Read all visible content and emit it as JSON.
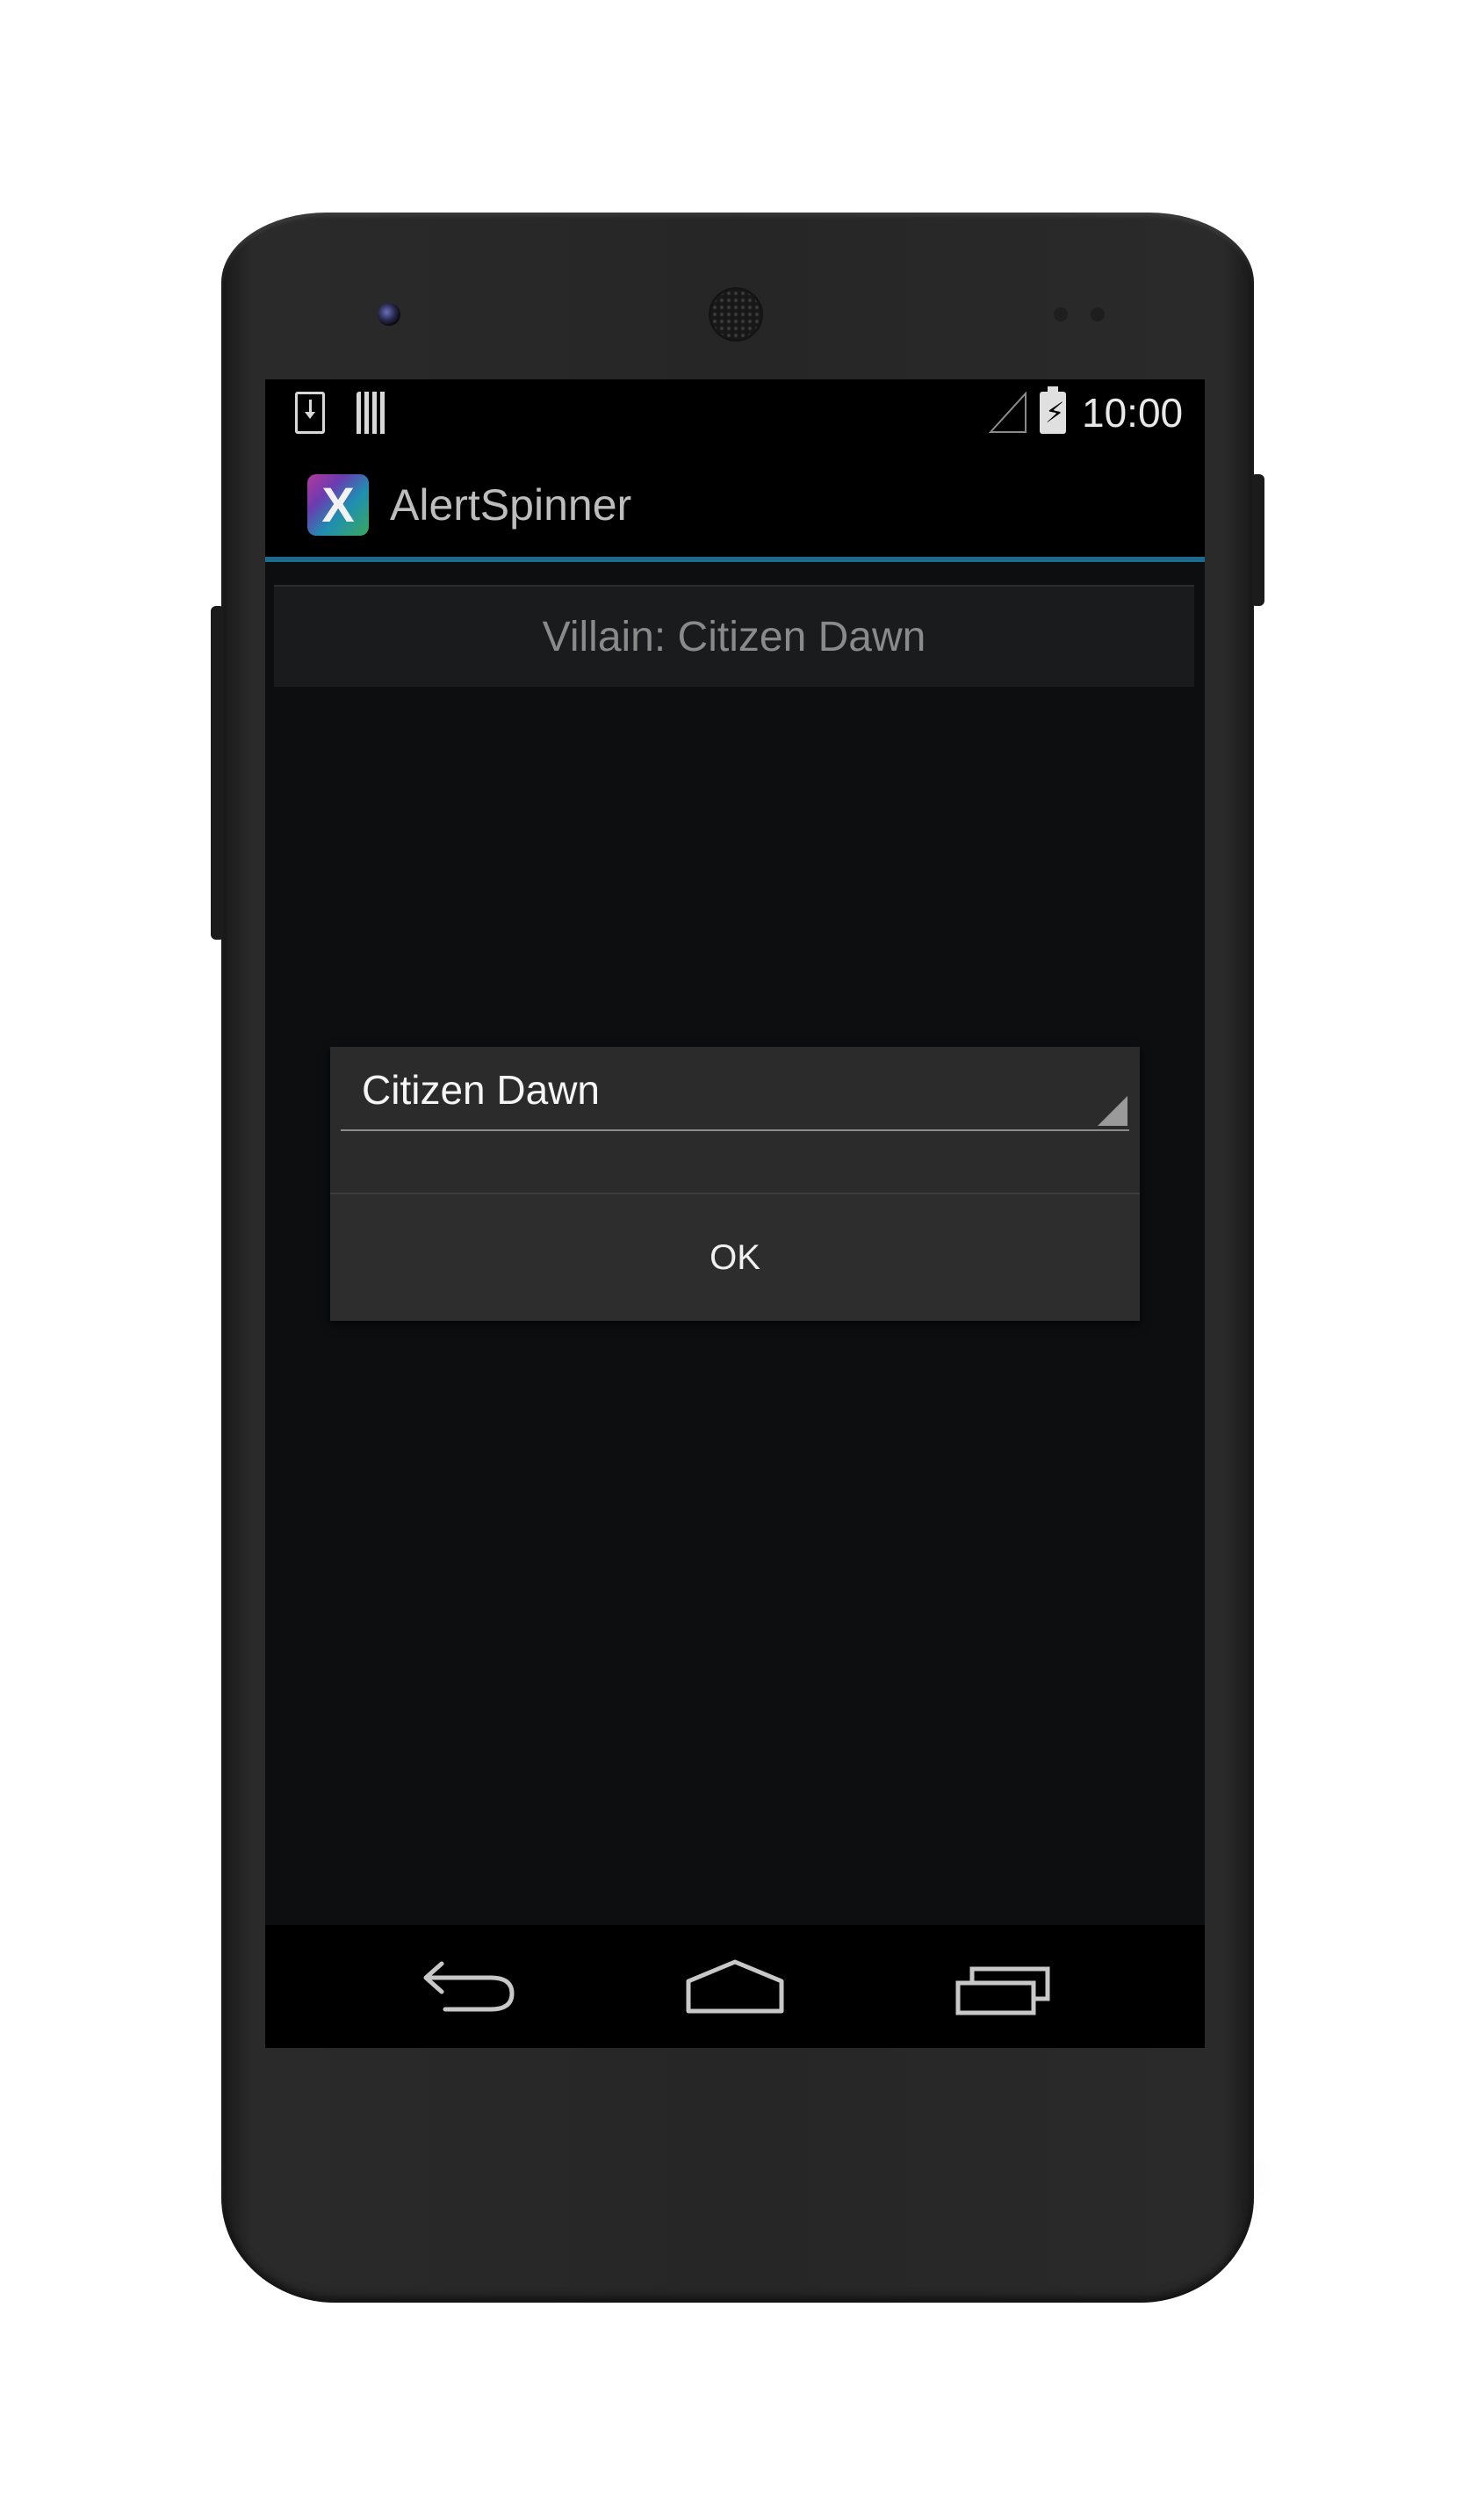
{
  "status_bar": {
    "time": "10:00",
    "icons": [
      "download-icon",
      "sd-card-icon",
      "signal-icon",
      "battery-charging-icon"
    ]
  },
  "action_bar": {
    "app_title": "AlertSpinner",
    "app_icon_glyph": "X",
    "accent_color": "#1b6b8f"
  },
  "main": {
    "spinner_label": "Villain: Citizen Dawn"
  },
  "dialog": {
    "selected_value": "Citizen Dawn",
    "ok_label": "OK"
  },
  "nav_bar": {
    "buttons": [
      "back-icon",
      "home-icon",
      "recent-apps-icon"
    ]
  }
}
